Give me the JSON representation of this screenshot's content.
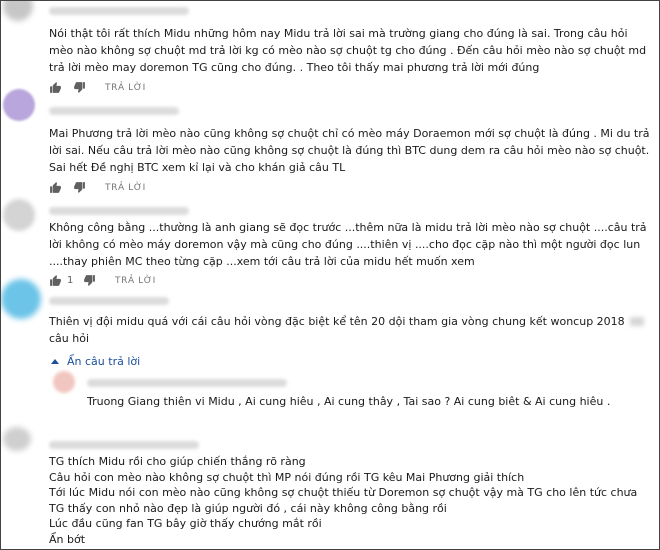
{
  "comments": [
    {
      "text": "Nói thật tôi rất thích Midu những hôm nay Midu trả lời sai mà trường giang cho đúng là sai. Trong câu hỏi mèo nào không sợ chuột md trả lời kg có mèo nào sợ chuột tg cho đúng . Đến câu hỏi mèo nào sợ chuột md trả lời mèo may doremon TG cũng cho đúng. . Theo tôi thấy mai phương trả lời mới đúng",
      "reply_label": "TRẢ LỜI"
    },
    {
      "text": "Mai Phương trả lời mèo nào cũng không sợ chuột chỉ có mèo máy Doraemon mới sợ chuột là đúng . Mi du trả lời sai. Nếu câu trả lời mèo nào cũng không sợ chuột là đúng thì BTC dung dem ra câu hỏi mèo nào sợ chuột. Sai hết Đề nghị BTC xem kỉ lại và cho khán giả câu TL",
      "reply_label": "TRẢ LỜI"
    },
    {
      "text": "Không công bằng ...thường là anh giang sẽ đọc trước ...thêm nữa là midu trả lời mèo nào sợ chuột ....câu trả lời không có mèo máy doremon vậy mà cũng cho đúng ....thiên vị ....cho đọc cặp nào thì một người đọc lun ....thay phiên MC theo từng cặp ...xem tới câu trả lời của midu hết muốn xem",
      "like_count": "1",
      "reply_label": "TRẢ LỜI"
    },
    {
      "text_before": "Thiên vị đội midu quá với cái câu hỏi vòng đặc biệt kể tên 20 dội tham gia vòng chung kết woncup 2018",
      "text_after": "câu hỏi",
      "hide_replies_label": "Ẩn câu trả lời"
    },
    {
      "text": "Truong Giang thiên vi Midu ,  Ai cung hiêu ,  Ai cung thây ,  Tai sao ?  Ai cung biêt & Ai cung hiêu ."
    },
    {
      "lines": [
        "TG thích Midu rồi cho giúp chiến thắng rõ ràng",
        "Câu hỏi con mèo nào không sợ chuột thì MP nói đúng rồi    TG kêu Mai Phương giải thích",
        "Tới lúc Midu nói con mèo nào cũng không sợ chuột thiếu từ Doremon sợ chuột vậy mà TG cho lên tức chưa",
        "TG thấy con nhỏ nào đẹp là giúp người đó , cái này không công bằng rồi",
        "Lúc đầu cũng fan TG bây giờ thấy chướng mắt rồi",
        "Ẩn bớt"
      ]
    }
  ],
  "colors": {
    "avatar_purple": "#b8a6dc",
    "avatar_pink": "#f2c6c0",
    "avatar_blue": "#6cc4e8",
    "link_blue": "#1a4f9c"
  }
}
